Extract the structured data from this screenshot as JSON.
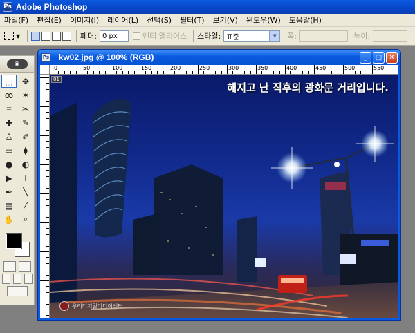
{
  "app": {
    "title": "Adobe Photoshop",
    "logo_icon": "photoshop-logo-icon"
  },
  "menu": [
    "파일(F)",
    "편집(E)",
    "이미지(I)",
    "레이어(L)",
    "선택(S)",
    "필터(T)",
    "보기(V)",
    "윈도우(W)",
    "도움말(H)"
  ],
  "options": {
    "feather_label": "페더:",
    "feather_value": "0 px",
    "antialias_label": "앤티 앨리어스",
    "style_label": "스타일:",
    "style_value": "표준",
    "width_label": "폭:",
    "height_label": "높이:"
  },
  "document": {
    "title": "_kw02.jpg @ 100% (RGB)",
    "ruler_labels": [
      "0",
      "50",
      "100",
      "150",
      "200",
      "250",
      "300",
      "350",
      "400",
      "450",
      "500",
      "550"
    ],
    "caption": "해지고 난 직후의 광화문 거리입니다.",
    "badge": "01",
    "watermark": "우리디지털미디어센터"
  },
  "toolbox": {
    "tools": [
      "marquee-icon",
      "move-icon",
      "lasso-icon",
      "magic-wand-icon",
      "crop-icon",
      "slice-icon",
      "healing-brush-icon",
      "brush-icon",
      "clone-stamp-icon",
      "history-brush-icon",
      "eraser-icon",
      "paint-bucket-icon",
      "blur-icon",
      "dodge-icon",
      "path-selection-icon",
      "type-icon",
      "pen-icon",
      "line-icon",
      "notes-icon",
      "eyedropper-icon",
      "hand-icon",
      "zoom-icon"
    ],
    "tool_glyphs": [
      "⬚",
      "✥",
      "ꝏ",
      "✶",
      "⌗",
      "✂",
      "✚",
      "✎",
      "♙",
      "✐",
      "▭",
      "⧫",
      "●",
      "◐",
      "▶",
      "T",
      "✒",
      "╲",
      "▤",
      "⁄",
      "✋",
      "⌕"
    ],
    "foreground_color": "#000000",
    "background_color": "#ffffff"
  }
}
